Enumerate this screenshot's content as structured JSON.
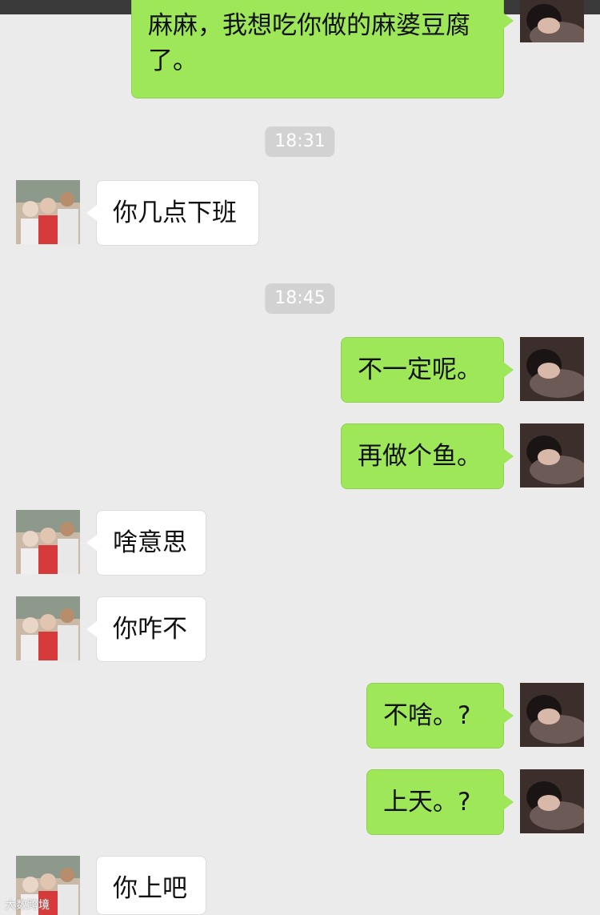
{
  "chat": {
    "messages": [
      {
        "side": "out",
        "text": "麻麻，我想吃你做的麻婆豆腐了。"
      },
      {
        "side": "time",
        "text": "18:31"
      },
      {
        "side": "in",
        "text": "你几点下班"
      },
      {
        "side": "time",
        "text": "18:45"
      },
      {
        "side": "out",
        "text": "不一定呢。"
      },
      {
        "side": "out",
        "text": "再做个鱼。"
      },
      {
        "side": "in",
        "text": "啥意思"
      },
      {
        "side": "in",
        "text": "你咋不"
      },
      {
        "side": "out",
        "text": "不啥。?"
      },
      {
        "side": "out",
        "text": "上天。?"
      },
      {
        "side": "in",
        "text": "你上吧"
      }
    ]
  },
  "watermark": {
    "text": "大数跨境"
  },
  "colors": {
    "outgoing_bubble": "#9de758",
    "incoming_bubble": "#ffffff",
    "background": "#ebebeb"
  }
}
